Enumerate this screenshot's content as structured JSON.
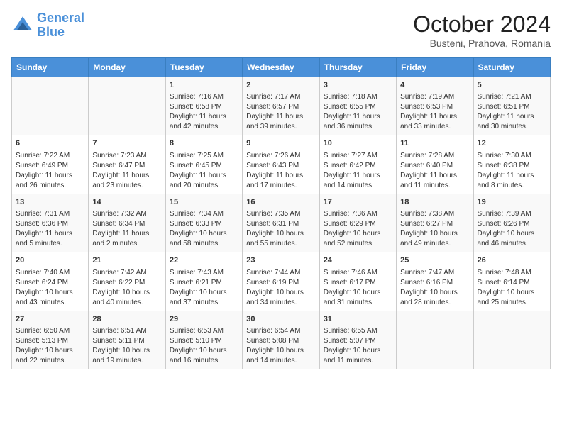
{
  "header": {
    "logo_line1": "General",
    "logo_line2": "Blue",
    "month": "October 2024",
    "location": "Busteni, Prahova, Romania"
  },
  "days_of_week": [
    "Sunday",
    "Monday",
    "Tuesday",
    "Wednesday",
    "Thursday",
    "Friday",
    "Saturday"
  ],
  "weeks": [
    [
      {
        "day": "",
        "content": ""
      },
      {
        "day": "",
        "content": ""
      },
      {
        "day": "1",
        "content": "Sunrise: 7:16 AM\nSunset: 6:58 PM\nDaylight: 11 hours and 42 minutes."
      },
      {
        "day": "2",
        "content": "Sunrise: 7:17 AM\nSunset: 6:57 PM\nDaylight: 11 hours and 39 minutes."
      },
      {
        "day": "3",
        "content": "Sunrise: 7:18 AM\nSunset: 6:55 PM\nDaylight: 11 hours and 36 minutes."
      },
      {
        "day": "4",
        "content": "Sunrise: 7:19 AM\nSunset: 6:53 PM\nDaylight: 11 hours and 33 minutes."
      },
      {
        "day": "5",
        "content": "Sunrise: 7:21 AM\nSunset: 6:51 PM\nDaylight: 11 hours and 30 minutes."
      }
    ],
    [
      {
        "day": "6",
        "content": "Sunrise: 7:22 AM\nSunset: 6:49 PM\nDaylight: 11 hours and 26 minutes."
      },
      {
        "day": "7",
        "content": "Sunrise: 7:23 AM\nSunset: 6:47 PM\nDaylight: 11 hours and 23 minutes."
      },
      {
        "day": "8",
        "content": "Sunrise: 7:25 AM\nSunset: 6:45 PM\nDaylight: 11 hours and 20 minutes."
      },
      {
        "day": "9",
        "content": "Sunrise: 7:26 AM\nSunset: 6:43 PM\nDaylight: 11 hours and 17 minutes."
      },
      {
        "day": "10",
        "content": "Sunrise: 7:27 AM\nSunset: 6:42 PM\nDaylight: 11 hours and 14 minutes."
      },
      {
        "day": "11",
        "content": "Sunrise: 7:28 AM\nSunset: 6:40 PM\nDaylight: 11 hours and 11 minutes."
      },
      {
        "day": "12",
        "content": "Sunrise: 7:30 AM\nSunset: 6:38 PM\nDaylight: 11 hours and 8 minutes."
      }
    ],
    [
      {
        "day": "13",
        "content": "Sunrise: 7:31 AM\nSunset: 6:36 PM\nDaylight: 11 hours and 5 minutes."
      },
      {
        "day": "14",
        "content": "Sunrise: 7:32 AM\nSunset: 6:34 PM\nDaylight: 11 hours and 2 minutes."
      },
      {
        "day": "15",
        "content": "Sunrise: 7:34 AM\nSunset: 6:33 PM\nDaylight: 10 hours and 58 minutes."
      },
      {
        "day": "16",
        "content": "Sunrise: 7:35 AM\nSunset: 6:31 PM\nDaylight: 10 hours and 55 minutes."
      },
      {
        "day": "17",
        "content": "Sunrise: 7:36 AM\nSunset: 6:29 PM\nDaylight: 10 hours and 52 minutes."
      },
      {
        "day": "18",
        "content": "Sunrise: 7:38 AM\nSunset: 6:27 PM\nDaylight: 10 hours and 49 minutes."
      },
      {
        "day": "19",
        "content": "Sunrise: 7:39 AM\nSunset: 6:26 PM\nDaylight: 10 hours and 46 minutes."
      }
    ],
    [
      {
        "day": "20",
        "content": "Sunrise: 7:40 AM\nSunset: 6:24 PM\nDaylight: 10 hours and 43 minutes."
      },
      {
        "day": "21",
        "content": "Sunrise: 7:42 AM\nSunset: 6:22 PM\nDaylight: 10 hours and 40 minutes."
      },
      {
        "day": "22",
        "content": "Sunrise: 7:43 AM\nSunset: 6:21 PM\nDaylight: 10 hours and 37 minutes."
      },
      {
        "day": "23",
        "content": "Sunrise: 7:44 AM\nSunset: 6:19 PM\nDaylight: 10 hours and 34 minutes."
      },
      {
        "day": "24",
        "content": "Sunrise: 7:46 AM\nSunset: 6:17 PM\nDaylight: 10 hours and 31 minutes."
      },
      {
        "day": "25",
        "content": "Sunrise: 7:47 AM\nSunset: 6:16 PM\nDaylight: 10 hours and 28 minutes."
      },
      {
        "day": "26",
        "content": "Sunrise: 7:48 AM\nSunset: 6:14 PM\nDaylight: 10 hours and 25 minutes."
      }
    ],
    [
      {
        "day": "27",
        "content": "Sunrise: 6:50 AM\nSunset: 5:13 PM\nDaylight: 10 hours and 22 minutes."
      },
      {
        "day": "28",
        "content": "Sunrise: 6:51 AM\nSunset: 5:11 PM\nDaylight: 10 hours and 19 minutes."
      },
      {
        "day": "29",
        "content": "Sunrise: 6:53 AM\nSunset: 5:10 PM\nDaylight: 10 hours and 16 minutes."
      },
      {
        "day": "30",
        "content": "Sunrise: 6:54 AM\nSunset: 5:08 PM\nDaylight: 10 hours and 14 minutes."
      },
      {
        "day": "31",
        "content": "Sunrise: 6:55 AM\nSunset: 5:07 PM\nDaylight: 10 hours and 11 minutes."
      },
      {
        "day": "",
        "content": ""
      },
      {
        "day": "",
        "content": ""
      }
    ]
  ]
}
